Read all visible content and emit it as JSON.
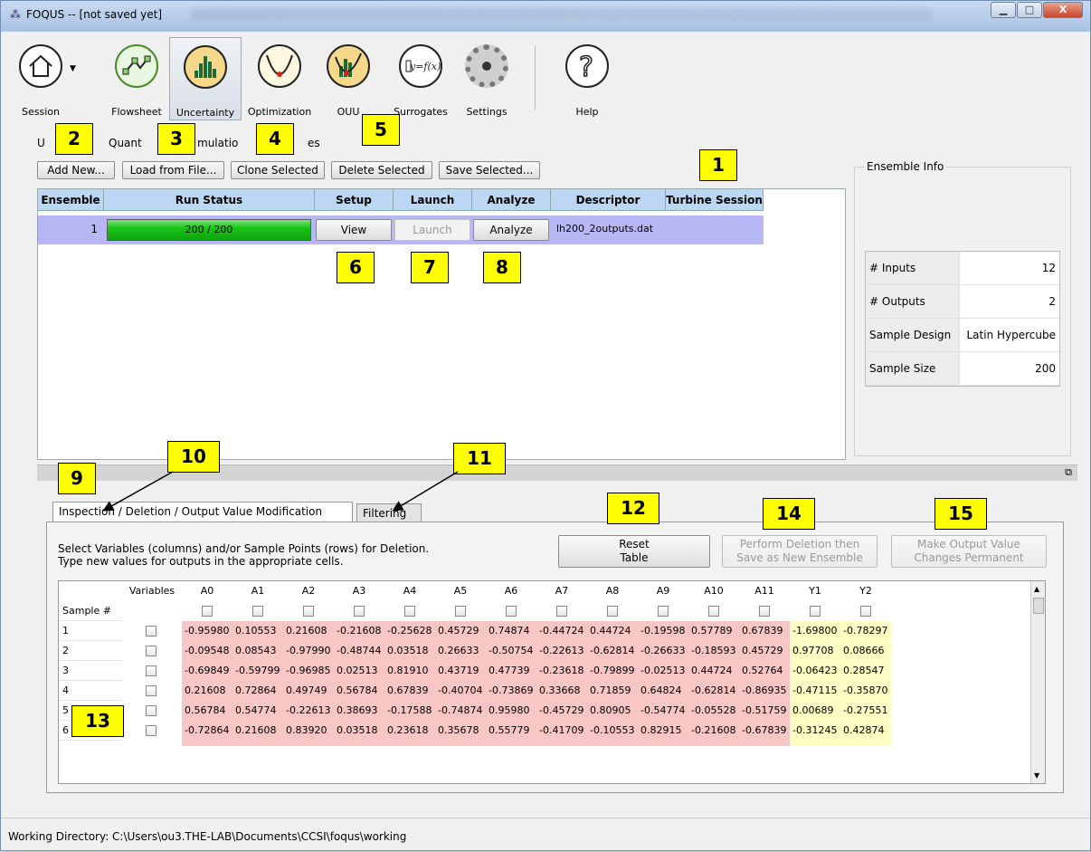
{
  "window": {
    "title": "FOQUS -- [not saved yet]",
    "buttons": {
      "minimize": "▁",
      "maximize": "□",
      "close": "X"
    }
  },
  "toolbar": {
    "items": [
      {
        "label": "Session",
        "icon": "house-icon"
      },
      {
        "label": "Flowsheet",
        "icon": "flowsheet-icon"
      },
      {
        "label": "Uncertainty",
        "icon": "histogram-icon"
      },
      {
        "label": "Optimization",
        "icon": "optimization-curve-icon"
      },
      {
        "label": "OUU",
        "icon": "ouu-icon"
      },
      {
        "label": "Surrogates",
        "icon": "surrogate-function-icon"
      },
      {
        "label": "Settings",
        "icon": "gear-icon"
      },
      {
        "label": "Help",
        "icon": "question-icon"
      }
    ]
  },
  "callouts": [
    "1",
    "2",
    "3",
    "4",
    "5",
    "6",
    "7",
    "8",
    "9",
    "10",
    "11",
    "12",
    "13",
    "14",
    "15"
  ],
  "uq_group": {
    "label": "Uncertainty Quantification Simulation Ensembles",
    "label_visible_parts": [
      "U",
      "Quant",
      "mulatio",
      "es"
    ]
  },
  "ensemble_buttons": {
    "add_new": "Add New...",
    "load_file": "Load from File...",
    "clone": "Clone Selected",
    "delete": "Delete Selected",
    "save": "Save Selected..."
  },
  "ensemble_table": {
    "headers": [
      "Ensemble",
      "Run Status",
      "Setup",
      "Launch",
      "Analyze",
      "Descriptor",
      "Turbine Session"
    ],
    "row": {
      "ensemble": "1",
      "run_status": "200 / 200",
      "progress": 1.0,
      "setup": "View",
      "launch": "Launch",
      "analyze": "Analyze",
      "descriptor": "lh200_2outputs.dat",
      "turbine_session": ""
    }
  },
  "ensemble_info": {
    "title": "Ensemble Info",
    "rows": [
      {
        "k": "# Inputs",
        "v": "12"
      },
      {
        "k": "# Outputs",
        "v": "2"
      },
      {
        "k": "Sample Design",
        "v": "Latin Hypercube"
      },
      {
        "k": "Sample Size",
        "v": "200"
      }
    ]
  },
  "tabs": {
    "inspection": "Inspection / Deletion / Output Value Modification",
    "filtering": "Filtering"
  },
  "inspection": {
    "instructions_1": "Select Variables (columns) and/or Sample Points (rows) for Deletion.",
    "instructions_2": "Type new values for outputs in the appropriate cells.",
    "reset_line1": "Reset",
    "reset_line2": "Table",
    "perform_line1": "Perform Deletion then",
    "perform_line2": "Save as New Ensemble",
    "make_line1": "Make Output Value",
    "make_line2": "Changes Permanent"
  },
  "grid": {
    "variables_header": "Variables",
    "sample_header": "Sample #",
    "columns": [
      "A0",
      "A1",
      "A2",
      "A3",
      "A4",
      "A5",
      "A6",
      "A7",
      "A8",
      "A9",
      "A10",
      "A11",
      "Y1",
      "Y2"
    ],
    "rows": [
      {
        "n": "1",
        "vals": [
          "-0.95980",
          "0.10553",
          "0.21608",
          "-0.21608",
          "-0.25628",
          "0.45729",
          "0.74874",
          "-0.44724",
          "0.44724",
          "-0.19598",
          "0.57789",
          "0.67839",
          "-1.69800",
          "-0.78297"
        ]
      },
      {
        "n": "2",
        "vals": [
          "-0.09548",
          "0.08543",
          "-0.97990",
          "-0.48744",
          "0.03518",
          "0.26633",
          "-0.50754",
          "-0.22613",
          "-0.62814",
          "-0.26633",
          "-0.18593",
          "0.45729",
          "0.97708",
          "0.08666"
        ]
      },
      {
        "n": "3",
        "vals": [
          "-0.69849",
          "-0.59799",
          "-0.96985",
          "0.02513",
          "0.81910",
          "0.43719",
          "0.47739",
          "-0.23618",
          "-0.79899",
          "-0.02513",
          "0.44724",
          "0.52764",
          "-0.06423",
          "0.28547"
        ]
      },
      {
        "n": "4",
        "vals": [
          "0.21608",
          "0.72864",
          "0.49749",
          "0.56784",
          "0.67839",
          "-0.40704",
          "-0.73869",
          "0.33668",
          "0.71859",
          "0.64824",
          "-0.62814",
          "-0.86935",
          "-0.47115",
          "-0.35870"
        ]
      },
      {
        "n": "5",
        "vals": [
          "0.56784",
          "0.54774",
          "-0.22613",
          "0.38693",
          "-0.17588",
          "-0.74874",
          "0.95980",
          "-0.45729",
          "0.80905",
          "-0.54774",
          "-0.05528",
          "-0.51759",
          "0.00689",
          "-0.27551"
        ]
      },
      {
        "n": "6",
        "vals": [
          "-0.72864",
          "0.21608",
          "0.83920",
          "0.03518",
          "0.23618",
          "0.35678",
          "0.55779",
          "-0.41709",
          "-0.10553",
          "0.82915",
          "-0.21608",
          "-0.67839",
          "-0.31245",
          "0.42874"
        ]
      }
    ]
  },
  "status": {
    "working_dir": "Working Directory: C:\\Users\\ou3.THE-LAB\\Documents\\CCSI\\foqus\\working"
  },
  "colors": {
    "input_cell": "#f9c6c6",
    "output_cell": "#fdfdc4",
    "ensemble_row": "#b7b7f5",
    "progress": "#18c418",
    "callout": "#ffff00"
  }
}
